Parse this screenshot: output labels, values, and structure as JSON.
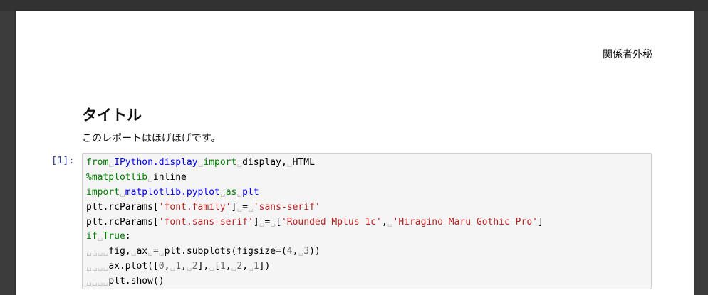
{
  "document": {
    "confidential_label": "関係者外秘",
    "title": "タイトル",
    "subtitle": "このレポートはほげほげです。"
  },
  "cell": {
    "prompt": "[1]:",
    "code_lines": [
      [
        [
          "kw",
          "from"
        ],
        [
          "sp",
          "␣"
        ],
        [
          "mod",
          "IPython.display"
        ],
        [
          "sp",
          "␣"
        ],
        [
          "kw",
          "import"
        ],
        [
          "sp",
          "␣"
        ],
        [
          "",
          "display,"
        ],
        [
          "sp",
          "␣"
        ],
        [
          "",
          "HTML"
        ]
      ],
      [
        [
          "magic",
          "%matplotlib"
        ],
        [
          "sp",
          "␣"
        ],
        [
          "",
          "inline"
        ]
      ],
      [
        [
          "kw",
          "import"
        ],
        [
          "sp",
          "␣"
        ],
        [
          "mod",
          "matplotlib.pyplot"
        ],
        [
          "sp",
          "␣"
        ],
        [
          "kw",
          "as"
        ],
        [
          "sp",
          "␣"
        ],
        [
          "mod",
          "plt"
        ]
      ],
      [
        [
          "",
          "plt.rcParams["
        ],
        [
          "str",
          "'font.family'"
        ],
        [
          "",
          "]"
        ],
        [
          "sp",
          "␣"
        ],
        [
          "",
          "="
        ],
        [
          "sp",
          "␣"
        ],
        [
          "str",
          "'sans-serif'"
        ]
      ],
      [
        [
          "",
          "plt.rcParams["
        ],
        [
          "str",
          "'font.sans-serif'"
        ],
        [
          "",
          "]"
        ],
        [
          "sp",
          "␣"
        ],
        [
          "",
          "="
        ],
        [
          "sp",
          "␣"
        ],
        [
          "",
          "["
        ],
        [
          "str",
          "'Rounded Mplus 1c'"
        ],
        [
          "",
          ","
        ],
        [
          "sp",
          "␣"
        ],
        [
          "str",
          "'Hiragino Maru Gothic Pro'"
        ],
        [
          "",
          "]"
        ]
      ],
      [
        [
          "kw",
          "if"
        ],
        [
          "sp",
          "␣"
        ],
        [
          "kw",
          "True"
        ],
        [
          "",
          ":"
        ]
      ],
      [
        [
          "sp",
          "␣␣␣␣"
        ],
        [
          "",
          "fig,"
        ],
        [
          "sp",
          "␣"
        ],
        [
          "",
          "ax"
        ],
        [
          "sp",
          "␣"
        ],
        [
          "",
          "="
        ],
        [
          "sp",
          "␣"
        ],
        [
          "",
          "plt.subplots(figsize=("
        ],
        [
          "num",
          "4"
        ],
        [
          "",
          ","
        ],
        [
          "sp",
          "␣"
        ],
        [
          "num",
          "3"
        ],
        [
          "",
          "))"
        ]
      ],
      [
        [
          "sp",
          "␣␣␣␣"
        ],
        [
          "",
          "ax.plot(["
        ],
        [
          "num",
          "0"
        ],
        [
          "",
          ","
        ],
        [
          "sp",
          "␣"
        ],
        [
          "num",
          "1"
        ],
        [
          "",
          ","
        ],
        [
          "sp",
          "␣"
        ],
        [
          "num",
          "2"
        ],
        [
          "",
          "],"
        ],
        [
          "sp",
          "␣"
        ],
        [
          "",
          "["
        ],
        [
          "num",
          "1"
        ],
        [
          "",
          ","
        ],
        [
          "sp",
          "␣"
        ],
        [
          "num",
          "2"
        ],
        [
          "",
          ","
        ],
        [
          "sp",
          "␣"
        ],
        [
          "num",
          "1"
        ],
        [
          "",
          "])"
        ]
      ],
      [
        [
          "sp",
          "␣␣␣␣"
        ],
        [
          "",
          "plt.show()"
        ]
      ]
    ]
  }
}
